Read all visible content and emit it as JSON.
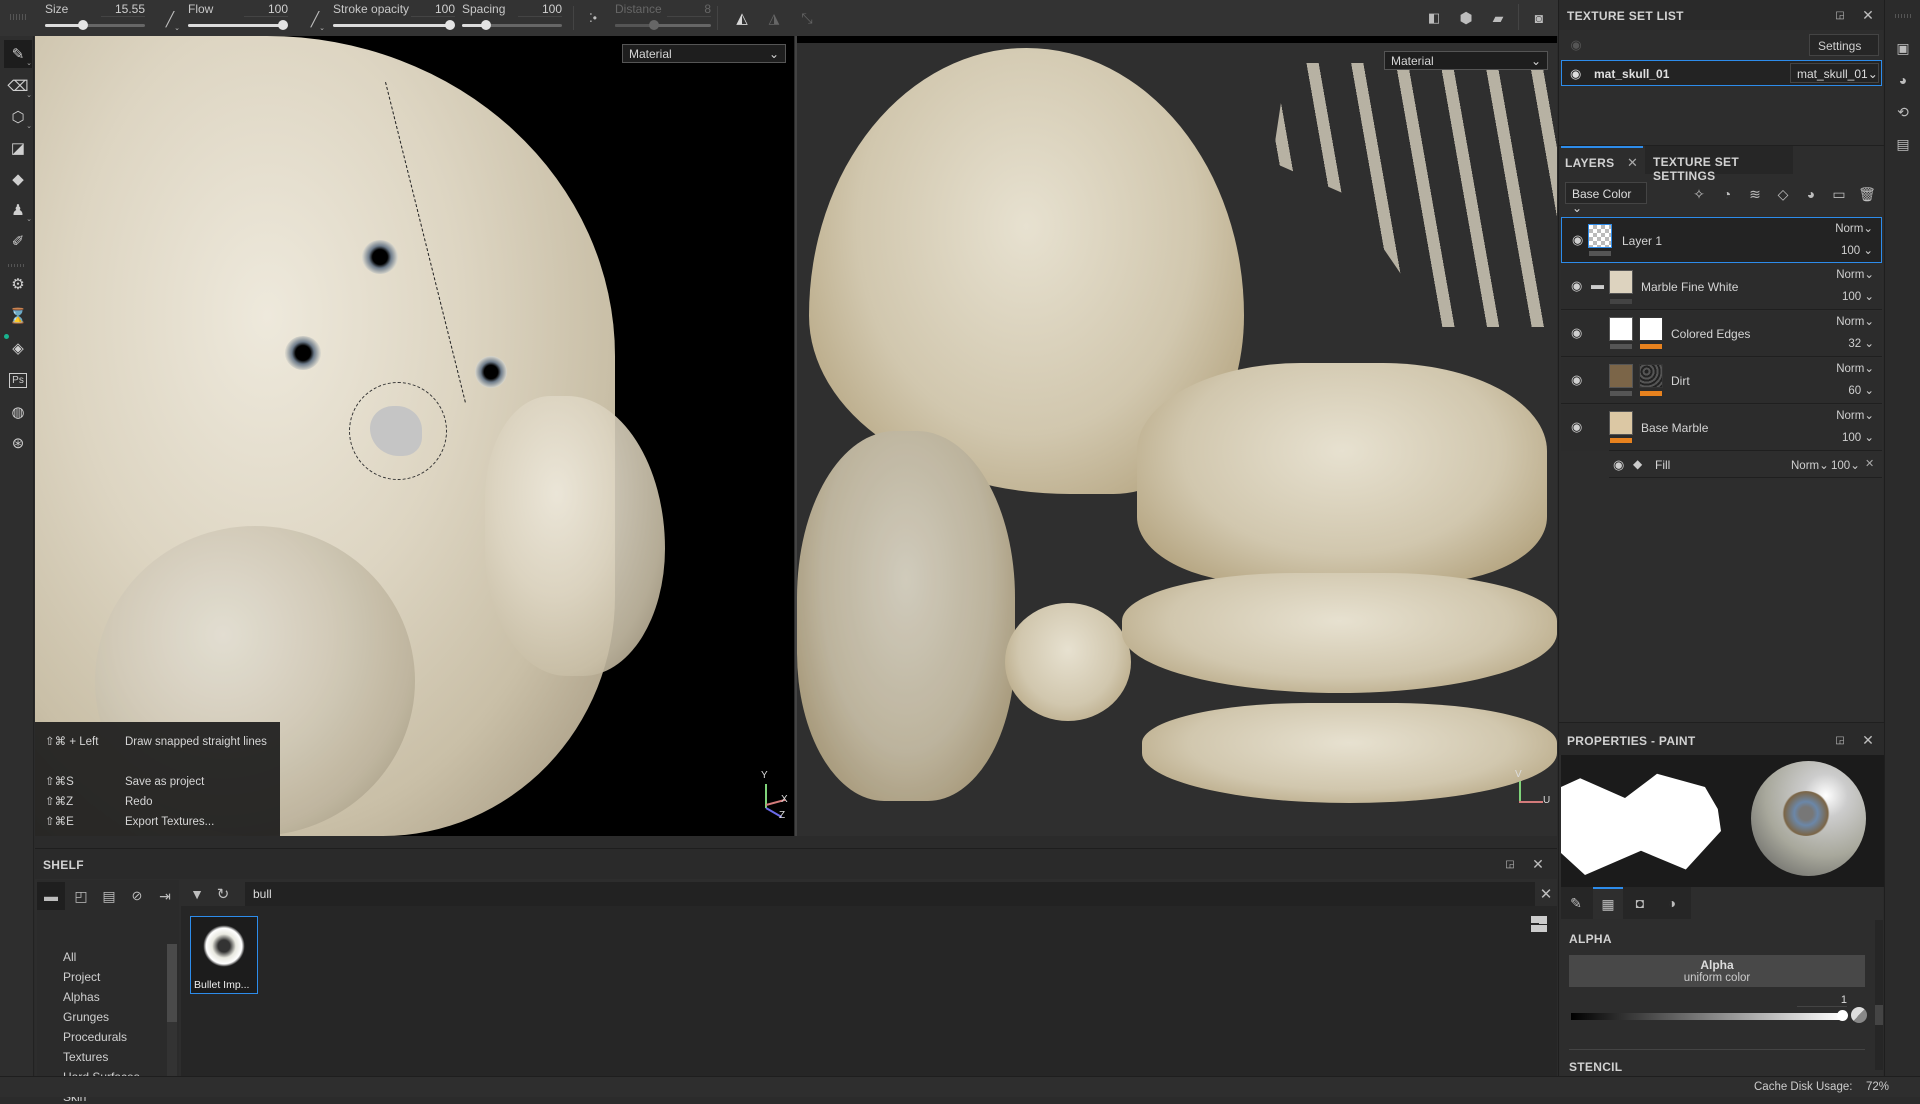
{
  "toolbar": {
    "size": {
      "label": "Size",
      "value": "15.55",
      "fraction": 0.42
    },
    "flow": {
      "label": "Flow",
      "value": "100",
      "fraction": 1.0
    },
    "stroke_opacity": {
      "label": "Stroke opacity",
      "value": "100",
      "fraction": 1.0
    },
    "spacing": {
      "label": "Spacing",
      "value": "100",
      "fraction": 0.27
    },
    "distance": {
      "label": "Distance",
      "value": "8",
      "fraction": 0.4
    },
    "icons": [
      "pen-pressure-icon",
      "lazy-mouse-icon",
      "symmetry-icon",
      "symmetry-settings-icon",
      "transform-axis-icon",
      "split-view-icon",
      "camera-cube-icon",
      "video-camera-icon",
      "screenshot-camera-icon"
    ]
  },
  "left_tools": [
    "paint-brush-icon",
    "eraser-icon",
    "projection-icon",
    "polygon-fill-icon",
    "smudge-icon",
    "clone-stamp-icon",
    "color-picker-icon",
    "substance-bake-icon",
    "hourglass-icon",
    "unity-icon",
    "photoshop-icon",
    "send-to-icon",
    "substance-share-icon"
  ],
  "viewport3d": {
    "mode_select": "Material",
    "axes": [
      "Y",
      "X",
      "Z"
    ]
  },
  "viewport2d": {
    "mode_select": "Material",
    "axes": [
      "V",
      "U"
    ]
  },
  "hints": [
    {
      "keys": "⇧⌘ + Left",
      "action": "Draw snapped straight lines"
    },
    {
      "keys": "⇧⌘S",
      "action": "Save as project"
    },
    {
      "keys": "⇧⌘Z",
      "action": "Redo"
    },
    {
      "keys": "⇧⌘E",
      "action": "Export Textures..."
    }
  ],
  "shelf": {
    "title": "SHELF",
    "search_value": "bull",
    "categories": [
      "All",
      "Project",
      "Alphas",
      "Grunges",
      "Procedurals",
      "Textures",
      "Hard Surfaces",
      "Skin"
    ],
    "items": [
      {
        "label": "Bullet Imp..."
      }
    ]
  },
  "texture_set_list": {
    "title": "TEXTURE SET LIST",
    "settings_label": "Settings",
    "sets": [
      {
        "name": "mat_skull_01",
        "material": "mat_skull_01"
      }
    ]
  },
  "layers": {
    "tabs": [
      {
        "label": "LAYERS",
        "active": true
      },
      {
        "label": "TEXTURE SET SETTINGS",
        "active": false
      }
    ],
    "channel": "Base Color",
    "items": [
      {
        "name": "Layer 1",
        "blend": "Norm",
        "opacity": "100",
        "selected": true
      },
      {
        "name": "Marble Fine White",
        "blend": "Norm",
        "opacity": "100",
        "folder": true
      },
      {
        "name": "Colored Edges",
        "blend": "Norm",
        "opacity": "32"
      },
      {
        "name": "Dirt",
        "blend": "Norm",
        "opacity": "60"
      },
      {
        "name": "Base Marble",
        "blend": "Norm",
        "opacity": "100"
      }
    ],
    "effect": {
      "name": "Fill",
      "blend": "Norm",
      "opacity": "100"
    }
  },
  "properties": {
    "title": "PROPERTIES - PAINT",
    "section_alpha": "ALPHA",
    "alpha_name": "Alpha",
    "alpha_sub": "uniform color",
    "alpha_value": "1",
    "section_stencil": "STENCIL"
  },
  "status": {
    "cache_label": "Cache Disk Usage:",
    "cache_value": "72%"
  },
  "colors": {
    "accent": "#2d8ceb",
    "mask_orange": "#e8821e",
    "panel": "#2d2d2d"
  }
}
